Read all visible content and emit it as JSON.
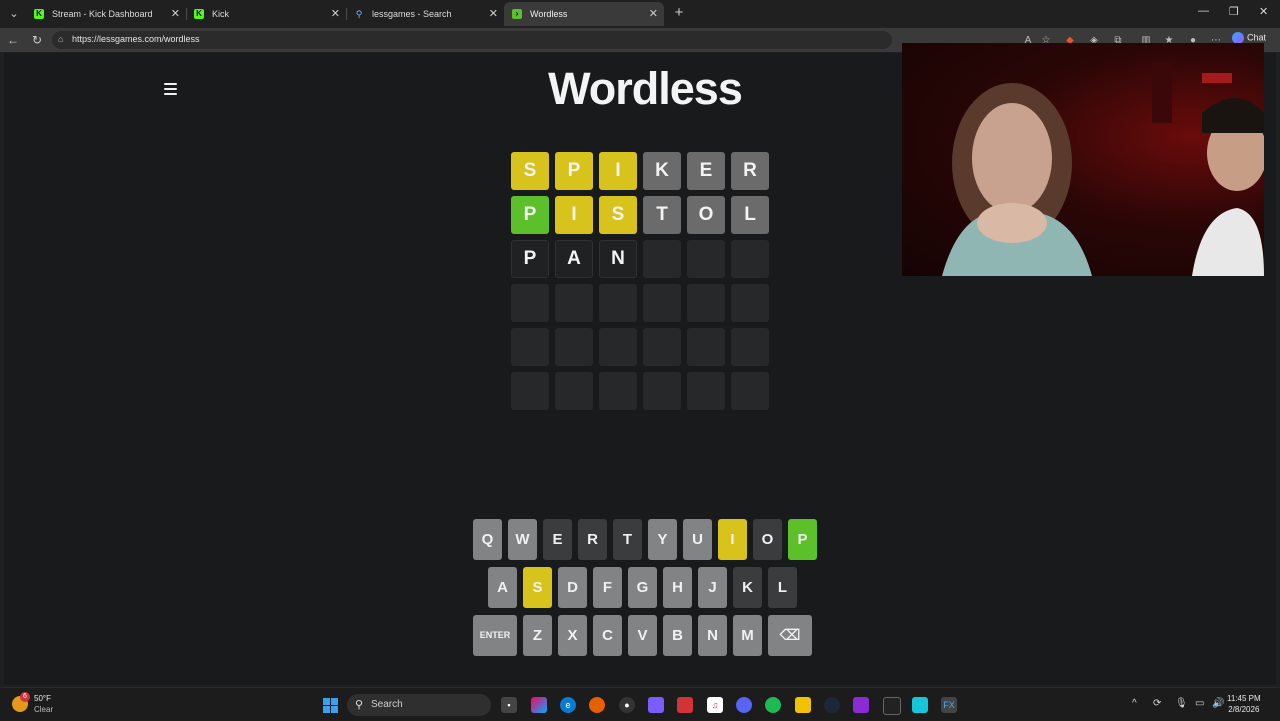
{
  "browser": {
    "tabs": [
      {
        "label": "Stream - Kick Dashboard",
        "favicon": "kick-icon",
        "active": false
      },
      {
        "label": "Kick",
        "favicon": "kick-icon",
        "active": false
      },
      {
        "label": "lessgames - Search",
        "favicon": "search-icon",
        "active": false
      },
      {
        "label": "Wordless",
        "favicon": "wordless-icon",
        "active": true
      }
    ],
    "url": "https://lessgames.com/wordless",
    "chat_label": "Chat"
  },
  "game": {
    "title": "Wordless",
    "rows": [
      [
        {
          "letter": "S",
          "state": "yellow"
        },
        {
          "letter": "P",
          "state": "yellow"
        },
        {
          "letter": "I",
          "state": "yellow"
        },
        {
          "letter": "K",
          "state": "gray"
        },
        {
          "letter": "E",
          "state": "gray"
        },
        {
          "letter": "R",
          "state": "gray"
        }
      ],
      [
        {
          "letter": "P",
          "state": "green"
        },
        {
          "letter": "I",
          "state": "yellow"
        },
        {
          "letter": "S",
          "state": "yellow"
        },
        {
          "letter": "T",
          "state": "gray"
        },
        {
          "letter": "O",
          "state": "gray"
        },
        {
          "letter": "L",
          "state": "gray"
        }
      ],
      [
        {
          "letter": "P",
          "state": "typed"
        },
        {
          "letter": "A",
          "state": "typed"
        },
        {
          "letter": "N",
          "state": "typed"
        },
        {
          "letter": "",
          "state": "empty"
        },
        {
          "letter": "",
          "state": "empty"
        },
        {
          "letter": "",
          "state": "empty"
        }
      ],
      [
        {
          "letter": "",
          "state": "empty"
        },
        {
          "letter": "",
          "state": "empty"
        },
        {
          "letter": "",
          "state": "empty"
        },
        {
          "letter": "",
          "state": "empty"
        },
        {
          "letter": "",
          "state": "empty"
        },
        {
          "letter": "",
          "state": "empty"
        }
      ],
      [
        {
          "letter": "",
          "state": "empty"
        },
        {
          "letter": "",
          "state": "empty"
        },
        {
          "letter": "",
          "state": "empty"
        },
        {
          "letter": "",
          "state": "empty"
        },
        {
          "letter": "",
          "state": "empty"
        },
        {
          "letter": "",
          "state": "empty"
        }
      ],
      [
        {
          "letter": "",
          "state": "empty"
        },
        {
          "letter": "",
          "state": "empty"
        },
        {
          "letter": "",
          "state": "empty"
        },
        {
          "letter": "",
          "state": "empty"
        },
        {
          "letter": "",
          "state": "empty"
        },
        {
          "letter": "",
          "state": "empty"
        }
      ]
    ],
    "keyboard": [
      [
        {
          "k": "Q",
          "s": "normal"
        },
        {
          "k": "W",
          "s": "normal"
        },
        {
          "k": "E",
          "s": "dark"
        },
        {
          "k": "R",
          "s": "dark"
        },
        {
          "k": "T",
          "s": "dark"
        },
        {
          "k": "Y",
          "s": "normal"
        },
        {
          "k": "U",
          "s": "normal"
        },
        {
          "k": "I",
          "s": "yellow"
        },
        {
          "k": "O",
          "s": "dark"
        },
        {
          "k": "P",
          "s": "green"
        }
      ],
      [
        {
          "k": "A",
          "s": "normal"
        },
        {
          "k": "S",
          "s": "yellow"
        },
        {
          "k": "D",
          "s": "normal"
        },
        {
          "k": "F",
          "s": "normal"
        },
        {
          "k": "G",
          "s": "normal"
        },
        {
          "k": "H",
          "s": "normal"
        },
        {
          "k": "J",
          "s": "normal"
        },
        {
          "k": "K",
          "s": "dark"
        },
        {
          "k": "L",
          "s": "dark"
        }
      ],
      [
        {
          "k": "ENTER",
          "s": "normal"
        },
        {
          "k": "Z",
          "s": "normal"
        },
        {
          "k": "X",
          "s": "normal"
        },
        {
          "k": "C",
          "s": "normal"
        },
        {
          "k": "V",
          "s": "normal"
        },
        {
          "k": "B",
          "s": "normal"
        },
        {
          "k": "N",
          "s": "normal"
        },
        {
          "k": "M",
          "s": "normal"
        },
        {
          "k": "⌫",
          "s": "normal"
        }
      ]
    ],
    "colors": {
      "yellow": "#d7c31b",
      "green": "#5cc02a",
      "gray": "#6b6b6b",
      "key": "#818384",
      "key_dark": "#3a3c3d"
    }
  },
  "taskbar": {
    "weather_temp": "50°F",
    "weather_cond": "Clear",
    "weather_badge": "6",
    "search_placeholder": "Search",
    "time": "11:45 PM",
    "date": "2/8/2026"
  }
}
